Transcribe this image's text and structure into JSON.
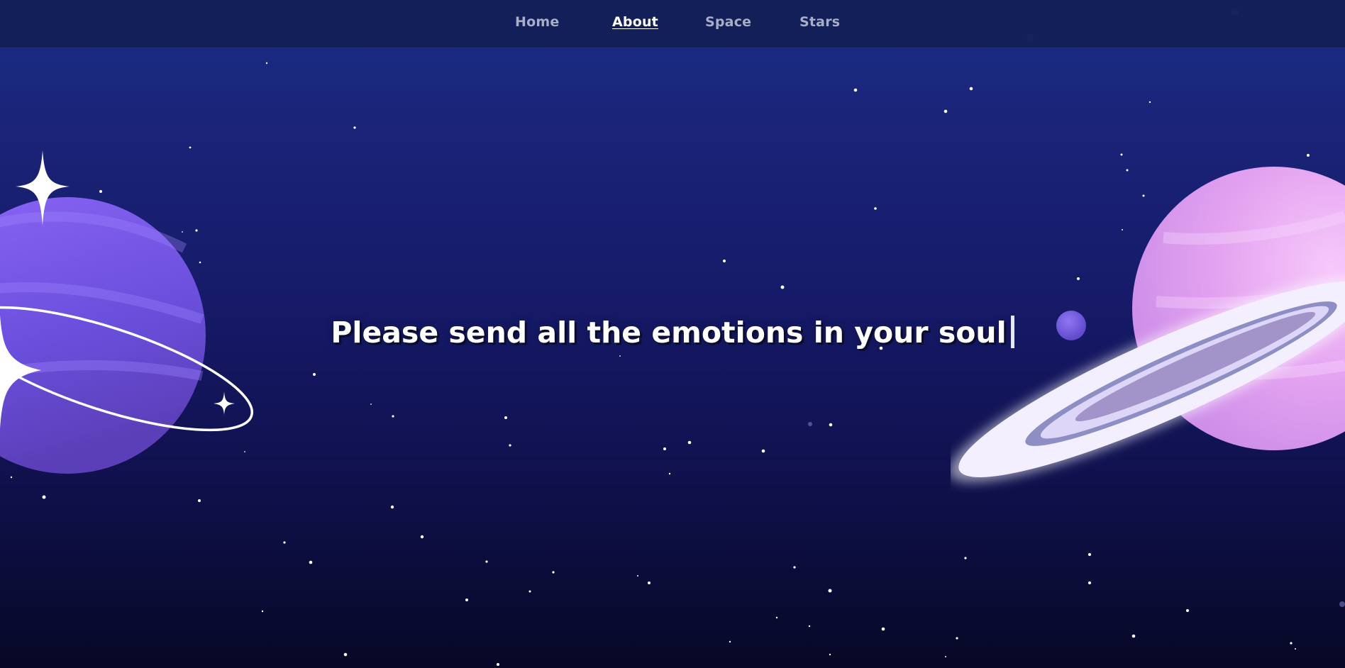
{
  "nav": {
    "items": [
      {
        "label": "Home",
        "active": false
      },
      {
        "label": "About",
        "active": true
      },
      {
        "label": "Space",
        "active": false
      },
      {
        "label": "Stars",
        "active": false
      }
    ]
  },
  "hero": {
    "headline": "Please send all the emotions in your soul"
  },
  "icons": {
    "left_planet": "purple-ringed-planet-icon",
    "right_planet": "pink-ringed-planet-icon",
    "moon": "small-moon-icon",
    "sparkle": "sparkle-star-icon"
  },
  "colors": {
    "background_top": "#1b2f86",
    "background_bottom": "#070826",
    "nav_background": "#121e55",
    "left_planet": "#7558e8",
    "right_planet": "#e7a9f2"
  }
}
